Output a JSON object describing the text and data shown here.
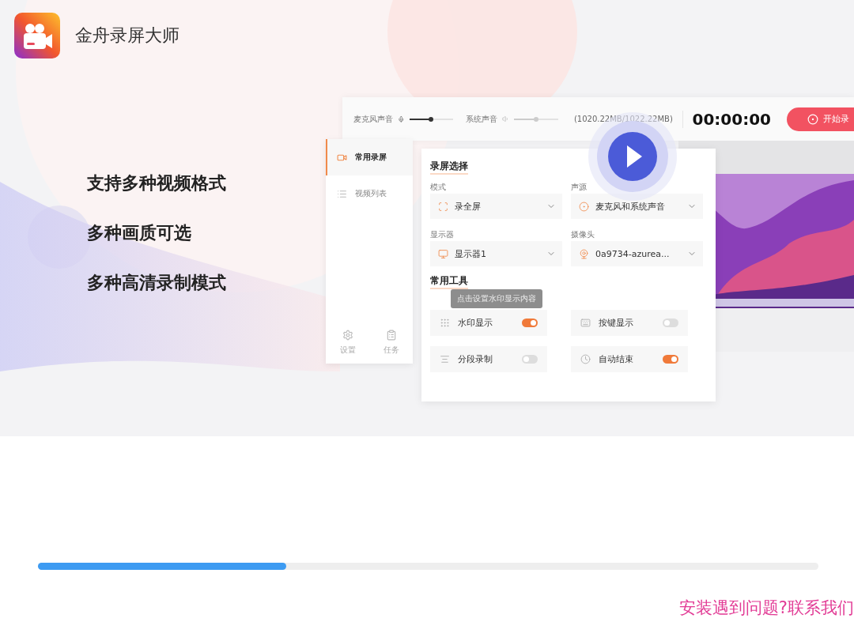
{
  "app": {
    "title": "金舟录屏大师"
  },
  "features": [
    "支持多种视频格式",
    "多种画质可选",
    "多种高清录制模式"
  ],
  "recorder": {
    "sliders": [
      {
        "label": "麦克风声音",
        "kind": "mic",
        "active": true,
        "level": 0.5
      },
      {
        "label": "系统声音",
        "kind": "speaker",
        "active": false,
        "level": 0.5
      }
    ],
    "storage": "(1020.22MB/1022.22MB)",
    "timer": "00:00:00",
    "start_button": "开始录"
  },
  "sidebar": {
    "items": [
      {
        "label": "常用录屏",
        "kind": "camera",
        "selected": true
      },
      {
        "label": "视频列表",
        "kind": "list",
        "selected": false
      }
    ],
    "footer": [
      {
        "label": "设置",
        "kind": "settings"
      },
      {
        "label": "任务",
        "kind": "task"
      }
    ]
  },
  "panel": {
    "title": "录屏选择",
    "fields": [
      {
        "label": "模式",
        "value": "录全屏",
        "kind": "screen"
      },
      {
        "label": "声源",
        "value": "麦克风和系统声音",
        "kind": "audio"
      },
      {
        "label": "显示器",
        "value": "显示器1",
        "kind": "monitor"
      },
      {
        "label": "摄像头",
        "value": "0a9734-azurea...",
        "kind": "camera"
      }
    ],
    "tools_title": "常用工具",
    "tooltip": "点击设置水印显示内容",
    "tools": [
      {
        "label": "水印显示",
        "kind": "watermark",
        "on": true
      },
      {
        "label": "按键显示",
        "kind": "keys",
        "on": false
      },
      {
        "label": "分段录制",
        "kind": "segment",
        "on": false
      },
      {
        "label": "自动结束",
        "kind": "timer",
        "on": true
      }
    ]
  },
  "progress": {
    "level": 0.318
  },
  "help_link": "安装遇到问题?联系我们"
}
